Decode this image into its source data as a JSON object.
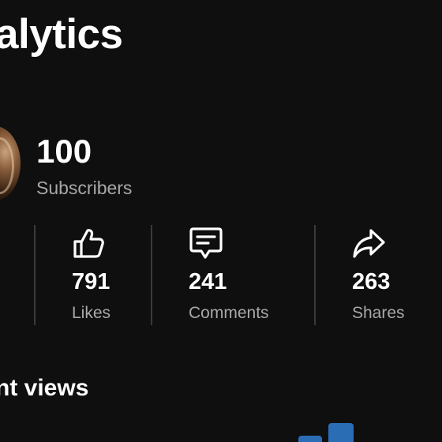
{
  "header": {
    "title": "alytics"
  },
  "channel": {
    "subscribers_count": "100",
    "subscribers_label": "Subscribers"
  },
  "stats": {
    "likes": {
      "value": "791",
      "label": "Likes",
      "icon": "thumbs-up-icon"
    },
    "comments": {
      "value": "241",
      "label": "Comments",
      "icon": "comment-icon"
    },
    "shares": {
      "value": "263",
      "label": "Shares",
      "icon": "share-icon"
    }
  },
  "recent_views": {
    "title": "nt views"
  },
  "colors": {
    "background": "#0f0f0f",
    "text_primary": "#ffffff",
    "text_secondary": "#a8a8a8",
    "divider": "#3a3a3a",
    "bar": "#2a6db5"
  }
}
